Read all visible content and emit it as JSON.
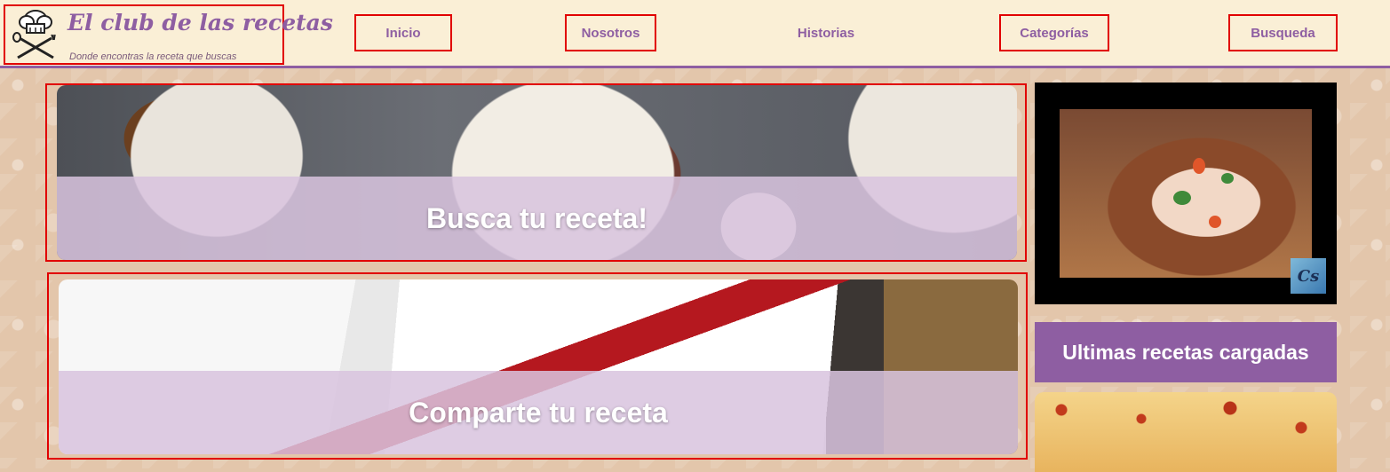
{
  "brand": {
    "title": "El club de las recetas",
    "tagline": "Donde encontras la receta que buscas"
  },
  "nav": [
    {
      "label": "Inicio"
    },
    {
      "label": "Nosotros"
    },
    {
      "label": "Historias"
    },
    {
      "label": "Categorías"
    },
    {
      "label": "Busqueda"
    }
  ],
  "banners": {
    "search": {
      "label": "Busca tu receta!"
    },
    "share": {
      "label": "Comparte tu receta"
    }
  },
  "sidebar": {
    "video_badge": "Cs",
    "latest_title": "Ultimas recetas cargadas"
  },
  "colors": {
    "accent": "#8e5ea2",
    "header_bg": "#faefd6",
    "page_bg": "#e3c6ab",
    "highlight_border": "#e10000"
  }
}
